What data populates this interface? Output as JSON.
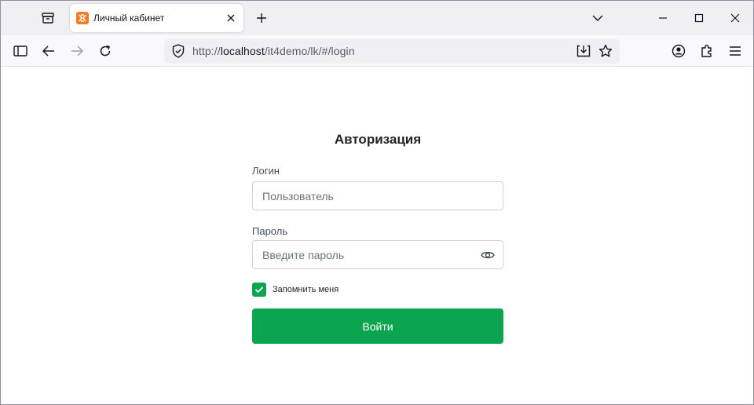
{
  "browser": {
    "tab": {
      "title": "Личный кабинет",
      "favicon": "xampp-icon"
    },
    "url": {
      "scheme": "http://",
      "host": "localhost",
      "path": "/it4demo/lk/#/login"
    },
    "icons": {
      "tab_overview": "tab-overview-icon",
      "tab_close": "close-icon",
      "new_tab": "plus-icon",
      "list_all_tabs": "chevron-down-icon",
      "minimize": "minimize-icon",
      "maximize": "maximize-icon",
      "close_window": "close-icon",
      "sidebar": "sidebar-icon",
      "back": "back-arrow-icon",
      "forward": "forward-arrow-icon",
      "reload": "reload-icon",
      "tracking_shield": "shield-icon",
      "save_page": "download-icon",
      "bookmark": "star-icon",
      "account": "account-icon",
      "extensions": "puzzle-icon",
      "menu": "hamburger-icon"
    }
  },
  "login": {
    "title": "Авторизация",
    "login_label": "Логин",
    "login_placeholder": "Пользователь",
    "password_label": "Пароль",
    "password_placeholder": "Введите пароль",
    "remember_label": "Запомнить меня",
    "remember_checked": true,
    "submit_label": "Войти"
  },
  "colors": {
    "accent": "#0ba54f",
    "favicon": "#fb7a24"
  }
}
